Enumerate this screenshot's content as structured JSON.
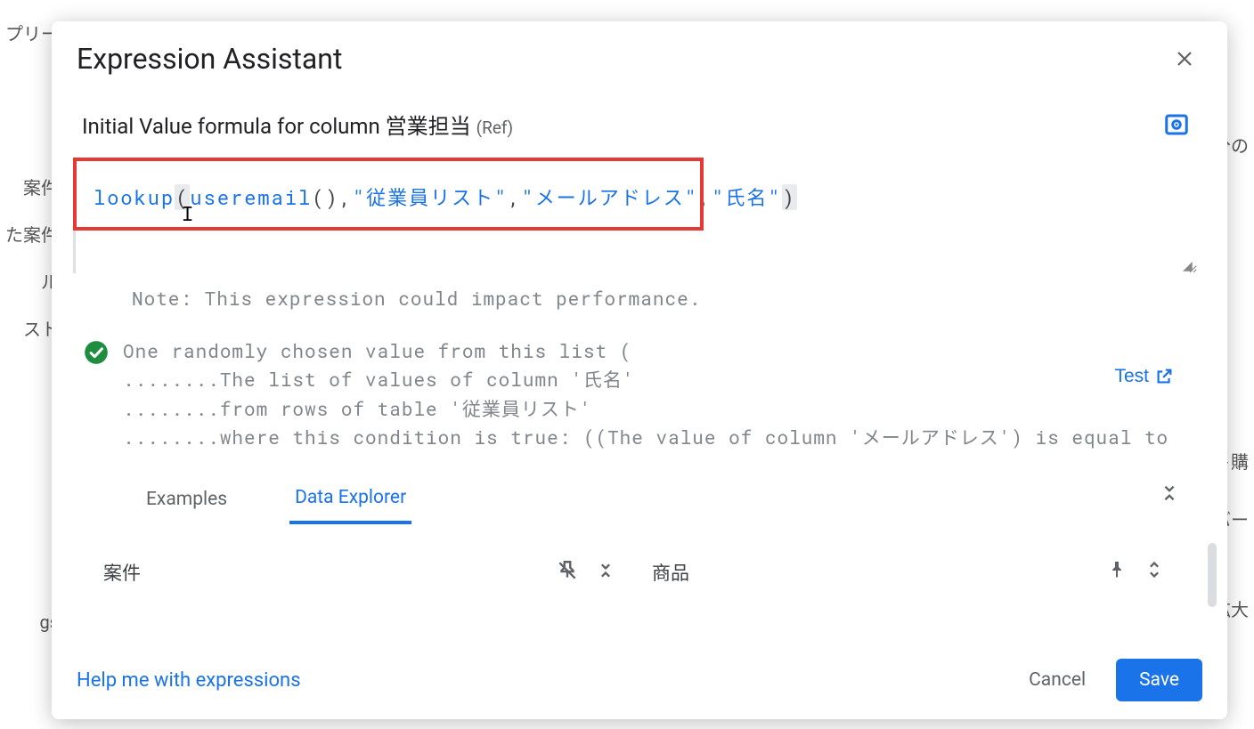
{
  "background": {
    "left_items": [
      "プリー",
      "",
      "案件",
      "た案件",
      "ル",
      "スト",
      "",
      "gs"
    ],
    "right_items": [
      "",
      "分の",
      "",
      "ト購",
      "バー",
      "",
      "拡大"
    ]
  },
  "modal": {
    "title": "Expression Assistant",
    "subtitle_prefix": "Initial Value formula for column ",
    "subtitle_column": "営業担当",
    "subtitle_ref": "(Ref)",
    "expression": {
      "func": "lookup",
      "inner_func": "useremail",
      "args": [
        "従業員リスト",
        "メールアドレス",
        "氏名"
      ],
      "raw": "lookup(useremail(),\"従業員リスト\",\"メールアドレス\",\"氏名\")"
    },
    "validation": {
      "note": "Note: This expression could impact performance.",
      "lines": [
        "One randomly chosen value from this list (",
        "........The list of values of column '氏名'",
        "........from rows of table '従業員リスト'",
        "........where this condition is true: ((The value of column 'メールアドレス') is equal to"
      ],
      "test_label": "Test"
    },
    "tabs": {
      "examples": "Examples",
      "data_explorer": "Data Explorer"
    },
    "data_explorer": {
      "col1": "案件",
      "col2": "商品"
    },
    "footer": {
      "help": "Help me with expressions",
      "cancel": "Cancel",
      "save": "Save"
    }
  }
}
